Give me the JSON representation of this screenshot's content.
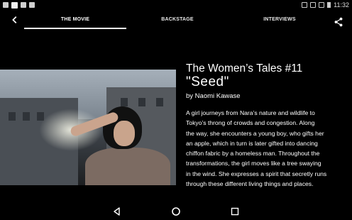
{
  "status_bar": {
    "time": "11:32"
  },
  "app_bar": {
    "back_icon": "back-arrow-icon",
    "tabs": [
      {
        "label": "THE MOVIE",
        "selected": true
      },
      {
        "label": "BACKSTAGE",
        "selected": false
      },
      {
        "label": "INTERVIEWS",
        "selected": false
      }
    ],
    "share_icon": "share-icon"
  },
  "content": {
    "title_line1": "The Women’s Tales #11",
    "title_line2": "\"Seed\"",
    "byline": "by Naomi Kawase",
    "description_lines": [
      "A girl journeys from Nara’s nature and wildlife to",
      "Tokyo’s throng of crowds and congestion. Along",
      "the way, she encounters a young boy, who gifts her",
      "an apple, which in turn is later gifted into dancing",
      "chiffon fabric by a homeless man. Throughout the",
      "transformations, the girl moves like a tree swaying",
      "in the wind. She expresses a spirit that secretly runs",
      "through these different living things and places."
    ]
  },
  "nav_bar": {
    "back_icon": "nav-back-icon",
    "home_icon": "nav-home-icon",
    "recents_icon": "nav-recents-icon"
  },
  "colors": {
    "background": "#000000",
    "text": "#ffffff",
    "tab_indicator": "#ffffff"
  }
}
